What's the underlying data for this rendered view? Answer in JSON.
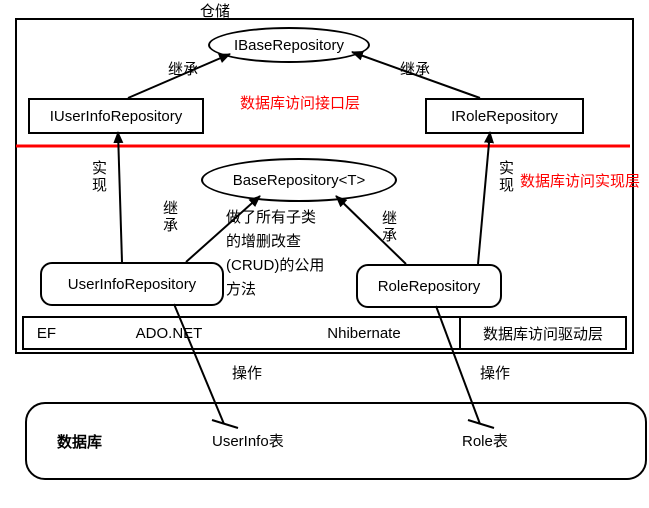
{
  "title": "仓储",
  "interfaceLayerLabel": "数据库访问接口层",
  "implLayerLabel": "数据库访问实现层",
  "driverLayerLabel": "数据库访问驱动层",
  "drivers": {
    "ef": "EF",
    "adonet": "ADO.NET",
    "nhibernate": "Nhibernate"
  },
  "nodes": {
    "ibase": "IBaseRepository",
    "iuser": "IUserInfoRepository",
    "irole": "IRoleRepository",
    "baseT": "BaseRepository<T>",
    "user": "UserInfoRepository",
    "role": "RoleRepository",
    "db": "数据库"
  },
  "edges": {
    "inheritLeft": "继承",
    "inheritRight": "继承",
    "implLeft": "实现",
    "implRight": "实现",
    "inheritUserBase": "继承",
    "inheritRoleBase": "继承",
    "opUser": "操作",
    "opRole": "操作"
  },
  "desc": {
    "line1": "做了所有子类",
    "line2": "的增删改查",
    "line3": "(CRUD)的公用",
    "line4": "方法"
  },
  "tables": {
    "user": "UserInfo表",
    "role": "Role表"
  }
}
